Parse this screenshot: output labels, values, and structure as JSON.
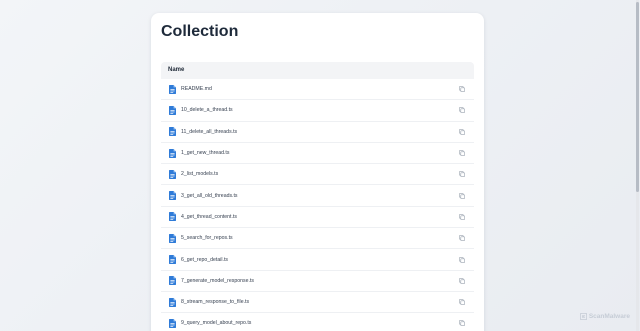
{
  "page": {
    "title": "Collection"
  },
  "table": {
    "header": "Name",
    "rows": [
      {
        "name": "README.md",
        "icon": "file-icon"
      },
      {
        "name": "10_delete_a_thread.ts",
        "icon": "file-icon"
      },
      {
        "name": "11_delete_all_threads.ts",
        "icon": "file-icon"
      },
      {
        "name": "1_get_new_thread.ts",
        "icon": "file-icon"
      },
      {
        "name": "2_list_models.ts",
        "icon": "file-icon"
      },
      {
        "name": "3_get_all_old_threads.ts",
        "icon": "file-icon"
      },
      {
        "name": "4_get_thread_content.ts",
        "icon": "file-icon"
      },
      {
        "name": "5_search_for_repos.ts",
        "icon": "file-icon"
      },
      {
        "name": "6_get_repo_detail.ts",
        "icon": "file-icon"
      },
      {
        "name": "7_generate_model_response.ts",
        "icon": "file-icon"
      },
      {
        "name": "8_stream_response_to_file.ts",
        "icon": "file-icon"
      },
      {
        "name": "9_query_model_about_repo.ts",
        "icon": "file-icon"
      }
    ]
  },
  "watermark": {
    "text": "ScanMalware",
    "icon": "scanmalware-logo-icon"
  },
  "colors": {
    "accent": "#2f7bd8",
    "title": "#1e2a3a",
    "muted_icon": "#9aa3af"
  }
}
